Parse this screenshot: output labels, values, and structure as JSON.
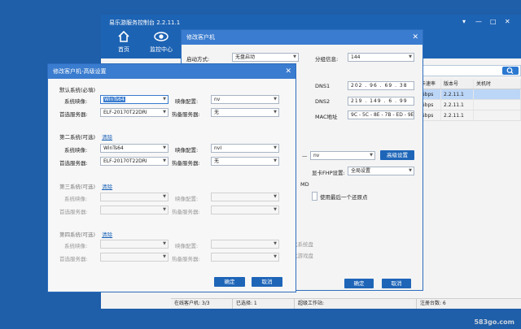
{
  "main": {
    "title": "易乐游服务控制台 2.2.11.1",
    "window_controls": [
      "▾",
      "—",
      "□",
      "✕"
    ],
    "nav": [
      {
        "label": "首页",
        "icon": "home-icon"
      },
      {
        "label": "监控中心",
        "icon": "eye-icon"
      }
    ],
    "grid": {
      "headers": [
        "卡速率",
        "版本号",
        "关机时"
      ],
      "rows": [
        [
          "Gbps",
          "2.2.11.1",
          ""
        ],
        [
          "Gbps",
          "2.2.11.1",
          ""
        ],
        [
          "Gbps",
          "2.2.11.1",
          ""
        ]
      ]
    },
    "status": {
      "online": "在线客户机: 3/3",
      "selected": "已选择: 1",
      "super": "超级工作站:",
      "registered": "注册台数: 6"
    },
    "watermark": "583go.com"
  },
  "client_dialog": {
    "title": "修改客户机",
    "close": "✕",
    "boot_mode_label": "启动方式:",
    "boot_mode_value": "无盘启动",
    "group_label": "分组信息:",
    "group_value": "144",
    "dns1_label": "DNS1",
    "dns1_value": "202 . 96 . 69 . 38",
    "dns2_label": "DNS2",
    "dns2_value": "219 . 149 . 6 . 99",
    "mac_label": "MAC地址",
    "mac_value": "9C - 5C - 8E - 7B - ED - 9E",
    "dash": "—",
    "nv_value": "nv",
    "adv_button": "高级设置",
    "nic_label": "显卡FHP设置:",
    "nic_value": "全局设置",
    "md_label": "MD",
    "restore_label": "使用最后一个还原点",
    "fragment1": "化系统盘",
    "fragment2": "化游戏盘",
    "ok": "确定",
    "cancel": "取消"
  },
  "adv_dialog": {
    "title": "修改客户机-高级设置",
    "close": "✕",
    "sections": [
      {
        "title": "默认系统(必填)",
        "clear": "",
        "image_label": "系统映像:",
        "image": "WinTs64",
        "config_label": "映像配置:",
        "config": "nv",
        "server_label": "首选服务器:",
        "server": "ELF-20170T22DRI",
        "hot_label": "热备服务器:",
        "hot": "无"
      },
      {
        "title": "第二系统(可选)",
        "clear": "清除",
        "image_label": "系统映像:",
        "image": "WinTs64",
        "config_label": "映像配置:",
        "config": "nvI",
        "server_label": "首选服务器:",
        "server": "ELF-20170T22DRI",
        "hot_label": "热备服务器:",
        "hot": "无"
      },
      {
        "title": "第三系统(可选)",
        "clear": "清除",
        "image_label": "系统映像:",
        "image": "",
        "config_label": "映像配置:",
        "config": "",
        "server_label": "首选服务器:",
        "server": "",
        "hot_label": "热备服务器:",
        "hot": ""
      },
      {
        "title": "第四系统(可选)",
        "clear": "清除",
        "image_label": "系统映像:",
        "image": "",
        "config_label": "映像配置:",
        "config": "",
        "server_label": "首选服务器:",
        "server": "",
        "hot_label": "热备服务器:",
        "hot": ""
      }
    ],
    "ok": "确定",
    "cancel": "取消"
  }
}
